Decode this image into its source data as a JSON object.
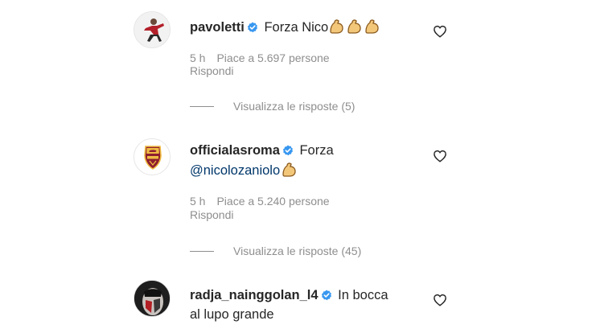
{
  "comments": [
    {
      "username": "pavoletti",
      "text": "Forza Nico",
      "time": "5 h",
      "likes": "Piace a 5.697 persone",
      "reply_label": "Rispondi",
      "view_replies": "Visualizza le risposte (5)"
    },
    {
      "username": "officialasroma",
      "text": "Forza",
      "mention": "@nicolozaniolo",
      "time": "5 h",
      "likes": "Piace a 5.240 persone",
      "reply_label": "Rispondi",
      "view_replies": "Visualizza le risposte (45)"
    },
    {
      "username": "radja_nainggolan_l4",
      "text": "In bocca",
      "text_line2": "al lupo grande"
    }
  ],
  "colors": {
    "verified_badge": "#3897f0",
    "secondary_text": "#8e8e8e",
    "mention": "#00376b",
    "roma_red": "#8e1f2f",
    "roma_gold": "#f0bc42"
  },
  "icons": {
    "verified": "verified-badge-icon",
    "like": "heart-outline-icon",
    "emoji": "flexed-biceps-emoji"
  }
}
